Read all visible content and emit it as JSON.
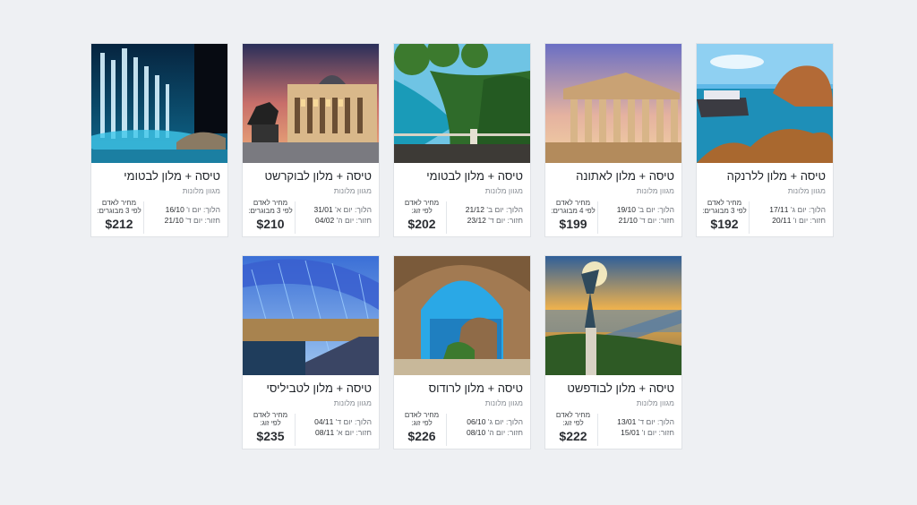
{
  "cards": [
    {
      "title": "טיסה + מלון לבטומי",
      "subtitle": "מגוון מלונות",
      "out_label": "הלוך: יום ו'",
      "out_date": "16/10",
      "ret_label": "חזור: יום ד'",
      "ret_date": "21/10",
      "price_label": "מחיר לאדם לפי 3 מבוגרים:",
      "price": "$212",
      "image": "fountain-photo"
    },
    {
      "title": "טיסה + מלון לבוקרשט",
      "subtitle": "מגוון מלונות",
      "out_label": "הלוך: יום א'",
      "out_date": "31/01",
      "ret_label": "חזור: יום ה'",
      "ret_date": "04/02",
      "price_label": "מחיר לאדם לפי 3 מבוגרים:",
      "price": "$210",
      "image": "palace-photo"
    },
    {
      "title": "טיסה + מלון לבטומי",
      "subtitle": "מגוון מלונות",
      "out_label": "הלוך: יום ב'",
      "out_date": "21/12",
      "ret_label": "חזור: יום ד'",
      "ret_date": "23/12",
      "price_label": "מחיר לאדם לפי זוג:",
      "price": "$202",
      "image": "coast-photo"
    },
    {
      "title": "טיסה + מלון לאתונה",
      "subtitle": "מגוון מלונות",
      "out_label": "הלוך: יום ב'",
      "out_date": "19/10",
      "ret_label": "חזור: יום ד'",
      "ret_date": "21/10",
      "price_label": "מחיר לאדם לפי 4 מבוגרים:",
      "price": "$199",
      "image": "parthenon-photo"
    },
    {
      "title": "טיסה + מלון ללרנקה",
      "subtitle": "מגוון מלונות",
      "out_label": "הלוך: יום ג'",
      "out_date": "17/11",
      "ret_label": "חזור: יום ו'",
      "ret_date": "20/11",
      "price_label": "מחיר לאדם לפי 3 מבוגרים:",
      "price": "$192",
      "image": "boat-rocks-photo"
    },
    {
      "title": "טיסה + מלון לטביליסי",
      "subtitle": "מגוון מלונות",
      "out_label": "הלוך: יום ד'",
      "out_date": "04/11",
      "ret_label": "חזור: יום א'",
      "ret_date": "08/11",
      "price_label": "מחיר לאדם לפי זוג:",
      "price": "$235",
      "image": "bridge-photo"
    },
    {
      "title": "טיסה + מלון לרודוס",
      "subtitle": "מגוון מלונות",
      "out_label": "הלוך: יום ג'",
      "out_date": "06/10",
      "ret_label": "חזור: יום ה'",
      "ret_date": "08/10",
      "price_label": "מחיר לאדם לפי זוג:",
      "price": "$226",
      "image": "arch-photo"
    },
    {
      "title": "טיסה + מלון לבודפשט",
      "subtitle": "מגוון מלונות",
      "out_label": "הלוך: יום ד'",
      "out_date": "13/01",
      "ret_label": "חזור: יום ו'",
      "ret_date": "15/01",
      "price_label": "מחיר לאדם לפי זוג:",
      "price": "$222",
      "image": "statue-photo"
    }
  ]
}
